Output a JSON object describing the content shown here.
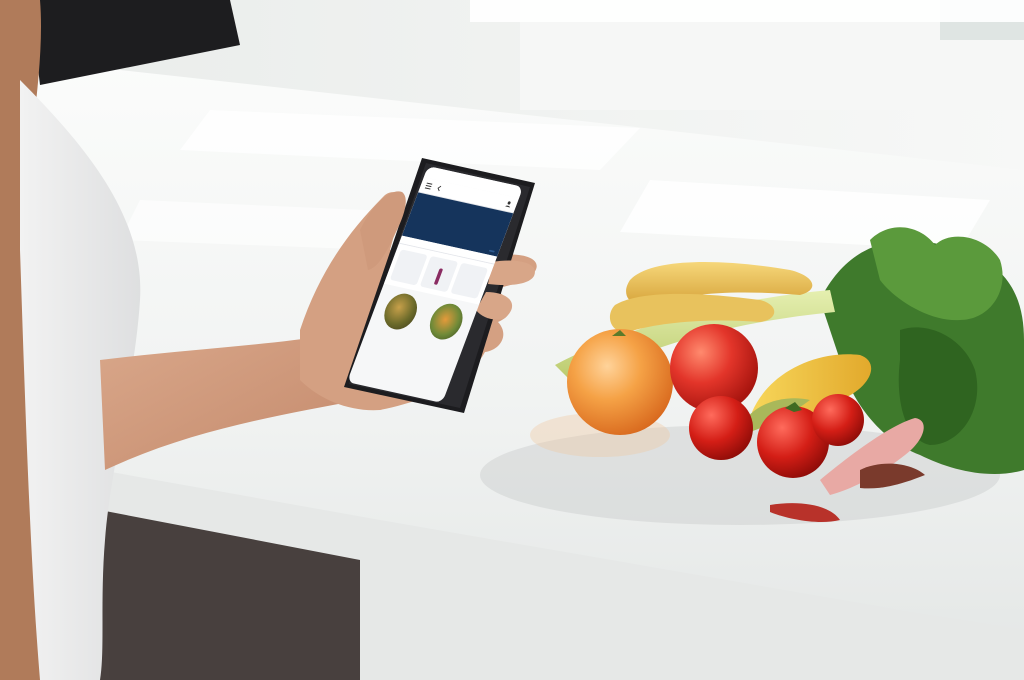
{
  "scene": {
    "description_tags": [
      "person-hand",
      "smartphone",
      "kitchen-counter",
      "fruits",
      "vegetables",
      "window"
    ],
    "colors": {
      "counter": "#f4f5f4",
      "phone_frame": "#1c1c1f",
      "app_header": "#15345c",
      "app_accent": "#8a2c62",
      "orange": "#f29a3c",
      "tomato": "#d62a1f",
      "banana": "#e9c15a",
      "greens": "#3f7a2c"
    }
  },
  "app": {
    "status_time": "",
    "status_icons": "",
    "title": "",
    "header": {
      "top_left": "",
      "top_right": "",
      "big_label": "",
      "chip_label": ""
    },
    "tabs": [
      {
        "label": ""
      },
      {
        "label": ""
      },
      {
        "label": ""
      }
    ],
    "stats": [
      {
        "label": "",
        "level": 0.0
      },
      {
        "label": "",
        "level": 0.7
      },
      {
        "label": "",
        "level": 0.0
      }
    ],
    "cards": [
      {
        "line1": "",
        "line2": ""
      },
      {
        "line1": "",
        "line2": ""
      }
    ],
    "footer": [
      "",
      "",
      ""
    ]
  }
}
